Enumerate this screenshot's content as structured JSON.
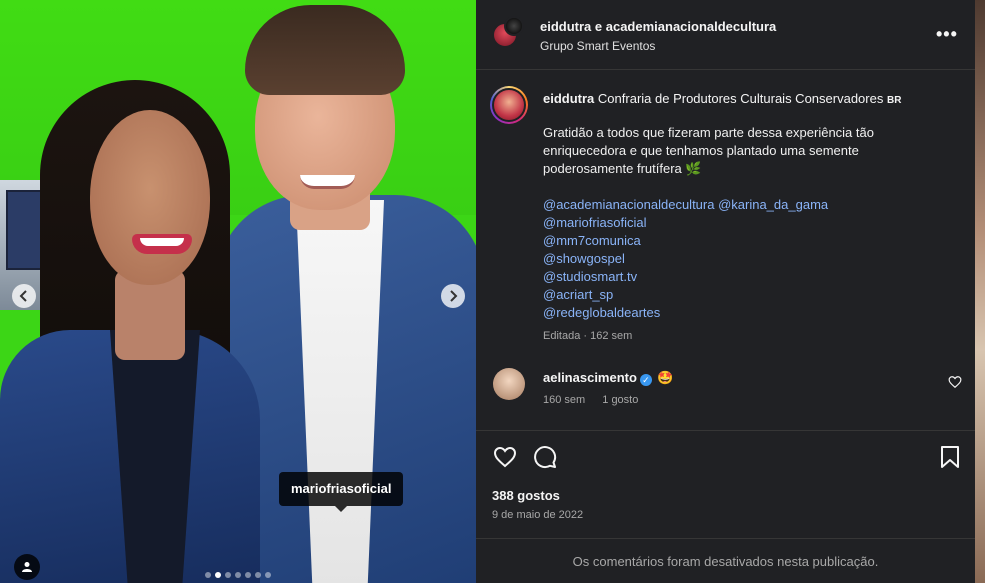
{
  "post": {
    "photo_tag": "mariofriasoficial",
    "carousel_index": 2,
    "carousel_total": 7,
    "icons": {
      "prev": "chevron-left-icon",
      "next": "chevron-right-icon",
      "user_tag": "person-icon"
    }
  },
  "header": {
    "title": "eiddutra e academianacionaldecultura",
    "subtitle": "Grupo Smart Eventos",
    "more_label": "•••"
  },
  "caption": {
    "username": "eiddutra",
    "text_first": "Confraria de Produtores Culturais Conservadores",
    "flag": "BR",
    "body": "Gratidão a todos que fizeram parte dessa experiência tão enriquecedora e que tenhamos plantado uma semente poderosamente frutífera 🌿",
    "mentions": [
      "@academianacionaldecultura @karina_da_gama",
      "@mariofriasoficial",
      "@mm7comunica",
      "@showgospel",
      "@studiosmart.tv",
      "@acriart_sp",
      "@redeglobaldeartes"
    ],
    "edited": "Editada · 162 sem"
  },
  "comment": {
    "username": "aelinascimento",
    "verified_mark": "✓",
    "emoji": "🤩",
    "time": "160 sem",
    "likes": "1 gosto"
  },
  "actions": {
    "likes": "388 gostos",
    "date": "9 de maio de 2022",
    "comments_disabled": "Os comentários foram desativados nesta publicação."
  },
  "colors": {
    "panel_bg": "#202124",
    "link": "#8ab4f8",
    "muted": "#a8a8a8"
  }
}
